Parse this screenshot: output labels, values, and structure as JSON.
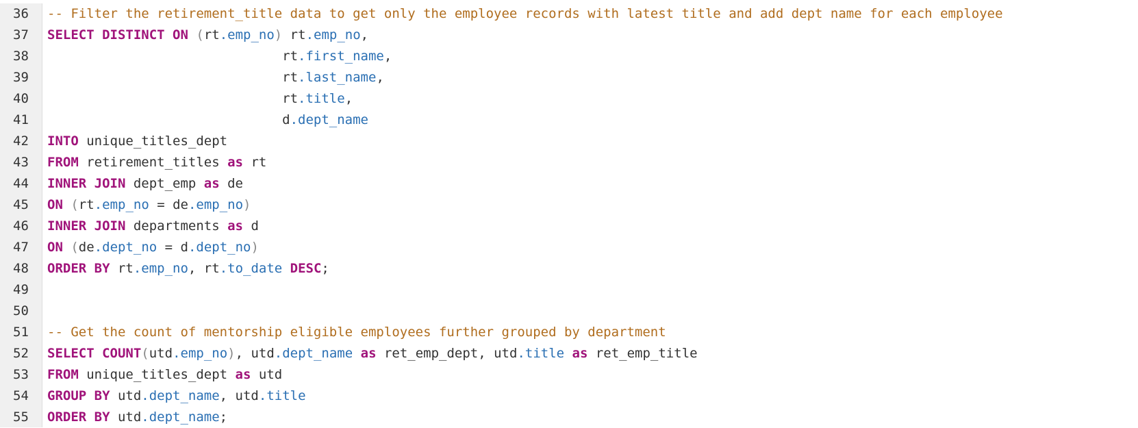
{
  "editor": {
    "line_numbers": [
      "36",
      "37",
      "38",
      "39",
      "40",
      "41",
      "42",
      "43",
      "44",
      "45",
      "46",
      "47",
      "48",
      "49",
      "50",
      "51",
      "52",
      "53",
      "54",
      "55"
    ],
    "colors": {
      "comment": "#b06d1e",
      "keyword": "#a0137a",
      "field": "#2a6fb3",
      "text": "#333333",
      "paren": "#888888",
      "gutter_bg": "#f0f0f0"
    },
    "lines": [
      [
        {
          "t": "cmt",
          "v": "-- Filter the retirement_title data to get only the employee records with latest title and add dept name for each employee"
        }
      ],
      [
        {
          "t": "kw",
          "v": "SELECT DISTINCT ON"
        },
        {
          "t": "pun",
          "v": " "
        },
        {
          "t": "par",
          "v": "("
        },
        {
          "t": "pun",
          "v": "rt"
        },
        {
          "t": "fld",
          "v": ".emp_no"
        },
        {
          "t": "par",
          "v": ")"
        },
        {
          "t": "pun",
          "v": " rt"
        },
        {
          "t": "fld",
          "v": ".emp_no"
        },
        {
          "t": "pun",
          "v": ","
        }
      ],
      [
        {
          "t": "pun",
          "v": "                              rt"
        },
        {
          "t": "fld",
          "v": ".first_name"
        },
        {
          "t": "pun",
          "v": ","
        }
      ],
      [
        {
          "t": "pun",
          "v": "                              rt"
        },
        {
          "t": "fld",
          "v": ".last_name"
        },
        {
          "t": "pun",
          "v": ","
        }
      ],
      [
        {
          "t": "pun",
          "v": "                              rt"
        },
        {
          "t": "fld",
          "v": ".title"
        },
        {
          "t": "pun",
          "v": ","
        }
      ],
      [
        {
          "t": "pun",
          "v": "                              d"
        },
        {
          "t": "fld",
          "v": ".dept_name"
        }
      ],
      [
        {
          "t": "kw",
          "v": "INTO"
        },
        {
          "t": "pun",
          "v": " unique_titles_dept"
        }
      ],
      [
        {
          "t": "kw",
          "v": "FROM"
        },
        {
          "t": "pun",
          "v": " retirement_titles "
        },
        {
          "t": "kw",
          "v": "as"
        },
        {
          "t": "pun",
          "v": " rt"
        }
      ],
      [
        {
          "t": "kw",
          "v": "INNER JOIN"
        },
        {
          "t": "pun",
          "v": " dept_emp "
        },
        {
          "t": "kw",
          "v": "as"
        },
        {
          "t": "pun",
          "v": " de"
        }
      ],
      [
        {
          "t": "kw",
          "v": "ON"
        },
        {
          "t": "pun",
          "v": " "
        },
        {
          "t": "par",
          "v": "("
        },
        {
          "t": "pun",
          "v": "rt"
        },
        {
          "t": "fld",
          "v": ".emp_no"
        },
        {
          "t": "pun",
          "v": " = de"
        },
        {
          "t": "fld",
          "v": ".emp_no"
        },
        {
          "t": "par",
          "v": ")"
        }
      ],
      [
        {
          "t": "kw",
          "v": "INNER JOIN"
        },
        {
          "t": "pun",
          "v": " departments "
        },
        {
          "t": "kw",
          "v": "as"
        },
        {
          "t": "pun",
          "v": " d"
        }
      ],
      [
        {
          "t": "kw",
          "v": "ON"
        },
        {
          "t": "pun",
          "v": " "
        },
        {
          "t": "par",
          "v": "("
        },
        {
          "t": "pun",
          "v": "de"
        },
        {
          "t": "fld",
          "v": ".dept_no"
        },
        {
          "t": "pun",
          "v": " = d"
        },
        {
          "t": "fld",
          "v": ".dept_no"
        },
        {
          "t": "par",
          "v": ")"
        }
      ],
      [
        {
          "t": "kw",
          "v": "ORDER BY"
        },
        {
          "t": "pun",
          "v": " rt"
        },
        {
          "t": "fld",
          "v": ".emp_no"
        },
        {
          "t": "pun",
          "v": ", rt"
        },
        {
          "t": "fld",
          "v": ".to_date"
        },
        {
          "t": "pun",
          "v": " "
        },
        {
          "t": "kw",
          "v": "DESC"
        },
        {
          "t": "pun",
          "v": ";"
        }
      ],
      [],
      [],
      [
        {
          "t": "cmt",
          "v": "-- Get the count of mentorship eligible employees further grouped by department"
        }
      ],
      [
        {
          "t": "kw",
          "v": "SELECT COUNT"
        },
        {
          "t": "par",
          "v": "("
        },
        {
          "t": "pun",
          "v": "utd"
        },
        {
          "t": "fld",
          "v": ".emp_no"
        },
        {
          "t": "par",
          "v": ")"
        },
        {
          "t": "pun",
          "v": ", utd"
        },
        {
          "t": "fld",
          "v": ".dept_name"
        },
        {
          "t": "pun",
          "v": " "
        },
        {
          "t": "kw",
          "v": "as"
        },
        {
          "t": "pun",
          "v": " ret_emp_dept, utd"
        },
        {
          "t": "fld",
          "v": ".title"
        },
        {
          "t": "pun",
          "v": " "
        },
        {
          "t": "kw",
          "v": "as"
        },
        {
          "t": "pun",
          "v": " ret_emp_title"
        }
      ],
      [
        {
          "t": "kw",
          "v": "FROM"
        },
        {
          "t": "pun",
          "v": " unique_titles_dept "
        },
        {
          "t": "kw",
          "v": "as"
        },
        {
          "t": "pun",
          "v": " utd"
        }
      ],
      [
        {
          "t": "kw",
          "v": "GROUP BY"
        },
        {
          "t": "pun",
          "v": " utd"
        },
        {
          "t": "fld",
          "v": ".dept_name"
        },
        {
          "t": "pun",
          "v": ", utd"
        },
        {
          "t": "fld",
          "v": ".title"
        }
      ],
      [
        {
          "t": "kw",
          "v": "ORDER BY"
        },
        {
          "t": "pun",
          "v": " utd"
        },
        {
          "t": "fld",
          "v": ".dept_name"
        },
        {
          "t": "pun",
          "v": ";"
        }
      ]
    ]
  }
}
